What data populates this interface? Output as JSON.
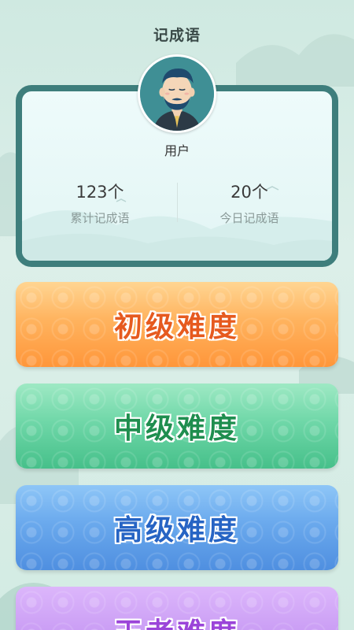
{
  "page": {
    "title": "记成语"
  },
  "user": {
    "name": "用户"
  },
  "stats": [
    {
      "value": "123个",
      "label": "累计记成语"
    },
    {
      "value": "20个",
      "label": "今日记成语"
    }
  ],
  "levels": [
    {
      "label": "初级难度"
    },
    {
      "label": "中级难度"
    },
    {
      "label": "高级难度"
    },
    {
      "label": "王者难度"
    }
  ],
  "colors": {
    "card_border": "#3e7e7c",
    "level1": "#ffb35e",
    "level2": "#6fd7a8",
    "level3": "#6aa9ed",
    "level4": "#c698f3"
  },
  "icons": {
    "avatar": "user-avatar-bearded-man"
  }
}
